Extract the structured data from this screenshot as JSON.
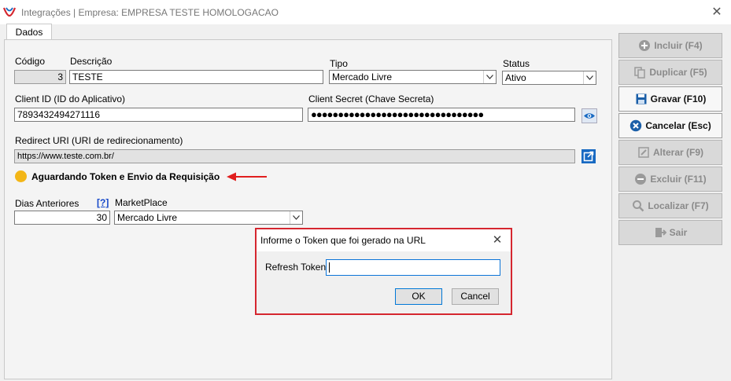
{
  "window": {
    "title": "Integrações | Empresa: EMPRESA TESTE HOMOLOGACAO",
    "close": "✕"
  },
  "tabs": [
    {
      "label": "Dados"
    }
  ],
  "form": {
    "codigo": {
      "label": "Código",
      "value": "3"
    },
    "descricao": {
      "label": "Descrição",
      "value": "TESTE"
    },
    "tipo": {
      "label": "Tipo",
      "value": "Mercado Livre"
    },
    "status": {
      "label": "Status",
      "value": "Ativo"
    },
    "client_id": {
      "label": "Client ID (ID do Aplicativo)",
      "value": "7893432494271116"
    },
    "client_secret": {
      "label": "Client Secret (Chave Secreta)",
      "value": "●●●●●●●●●●●●●●●●●●●●●●●●●●●●●●●●"
    },
    "redirect_uri": {
      "label": "Redirect URI (URI de redirecionamento)",
      "value": "https://www.teste.com.br/"
    },
    "status_message": "Aguardando Token e Envio da Requisição",
    "dias_anteriores": {
      "label": "Dias Anteriores",
      "value": "30",
      "help": "[?]"
    },
    "marketplace": {
      "label": "MarketPlace",
      "value": "Mercado Livre"
    }
  },
  "sidebar": {
    "buttons": [
      {
        "label": "Incluir (F4)",
        "enabled": false,
        "icon": "plus-circle-icon"
      },
      {
        "label": "Duplicar (F5)",
        "enabled": false,
        "icon": "duplicate-icon"
      },
      {
        "label": "Gravar (F10)",
        "enabled": true,
        "icon": "save-icon"
      },
      {
        "label": "Cancelar (Esc)",
        "enabled": true,
        "icon": "cancel-circle-icon"
      },
      {
        "label": "Alterar (F9)",
        "enabled": false,
        "icon": "edit-icon"
      },
      {
        "label": "Excluir (F11)",
        "enabled": false,
        "icon": "minus-circle-icon"
      },
      {
        "label": "Localizar (F7)",
        "enabled": false,
        "icon": "search-icon"
      },
      {
        "label": "Sair",
        "enabled": false,
        "icon": "exit-icon"
      }
    ]
  },
  "dialog": {
    "title": "Informe o Token que foi gerado na URL",
    "field_label": "Refresh Token",
    "field_value": "",
    "ok_label": "OK",
    "cancel_label": "Cancel"
  },
  "colors": {
    "status_dot": "#f3b617",
    "arrow": "#e11e1e",
    "dialog_border": "#d5262f",
    "accent": "#1769c2"
  }
}
